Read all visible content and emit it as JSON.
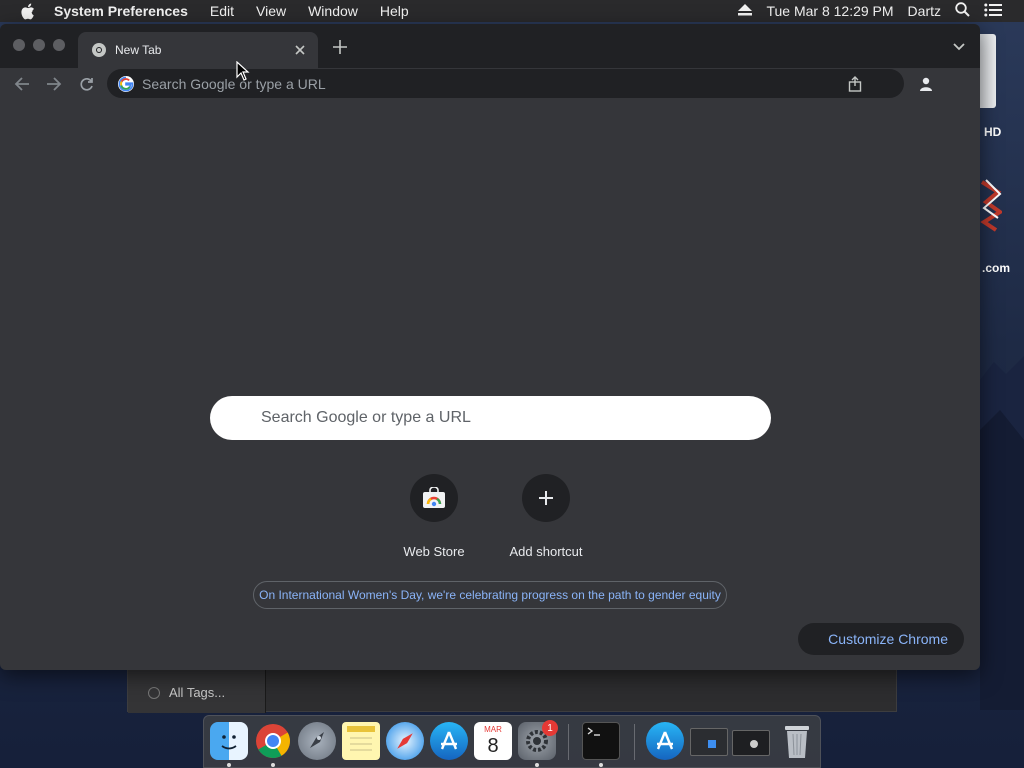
{
  "menubar": {
    "app_name": "System Preferences",
    "items": [
      "Edit",
      "View",
      "Window",
      "Help"
    ],
    "date_time": "Tue Mar 8  12:29 PM",
    "user": "Dartz"
  },
  "desktop": {
    "drive_label": "HD",
    "site_label": ".com"
  },
  "back_window": {
    "tag_label": "All Tags..."
  },
  "chrome": {
    "tab_title": "New Tab",
    "omnibox_placeholder": "Search Google or type a URL",
    "ntp_search_placeholder": "Search Google or type a URL",
    "shortcuts": [
      {
        "label": "Web Store",
        "icon": "web-store-icon"
      },
      {
        "label": "Add shortcut",
        "icon": "plus-icon"
      }
    ],
    "promo_text": "On International Women's Day, we're celebrating progress on the path to gender equity",
    "customize_label": "Customize Chrome"
  },
  "dock": {
    "apps": [
      "finder",
      "chrome",
      "launchpad",
      "notes",
      "safari",
      "app-store",
      "calendar",
      "system-preferences",
      "terminal",
      "app-store-2",
      "screenshot-1",
      "screenshot-2",
      "trash"
    ],
    "calendar_month": "MAR",
    "calendar_day": "8",
    "prefs_badge": "1"
  },
  "colors": {
    "chrome_bg": "#35363a",
    "tabstrip_bg": "#202124",
    "link_blue": "#8ab4f8",
    "menubar_bg": "#2a2a2c"
  }
}
